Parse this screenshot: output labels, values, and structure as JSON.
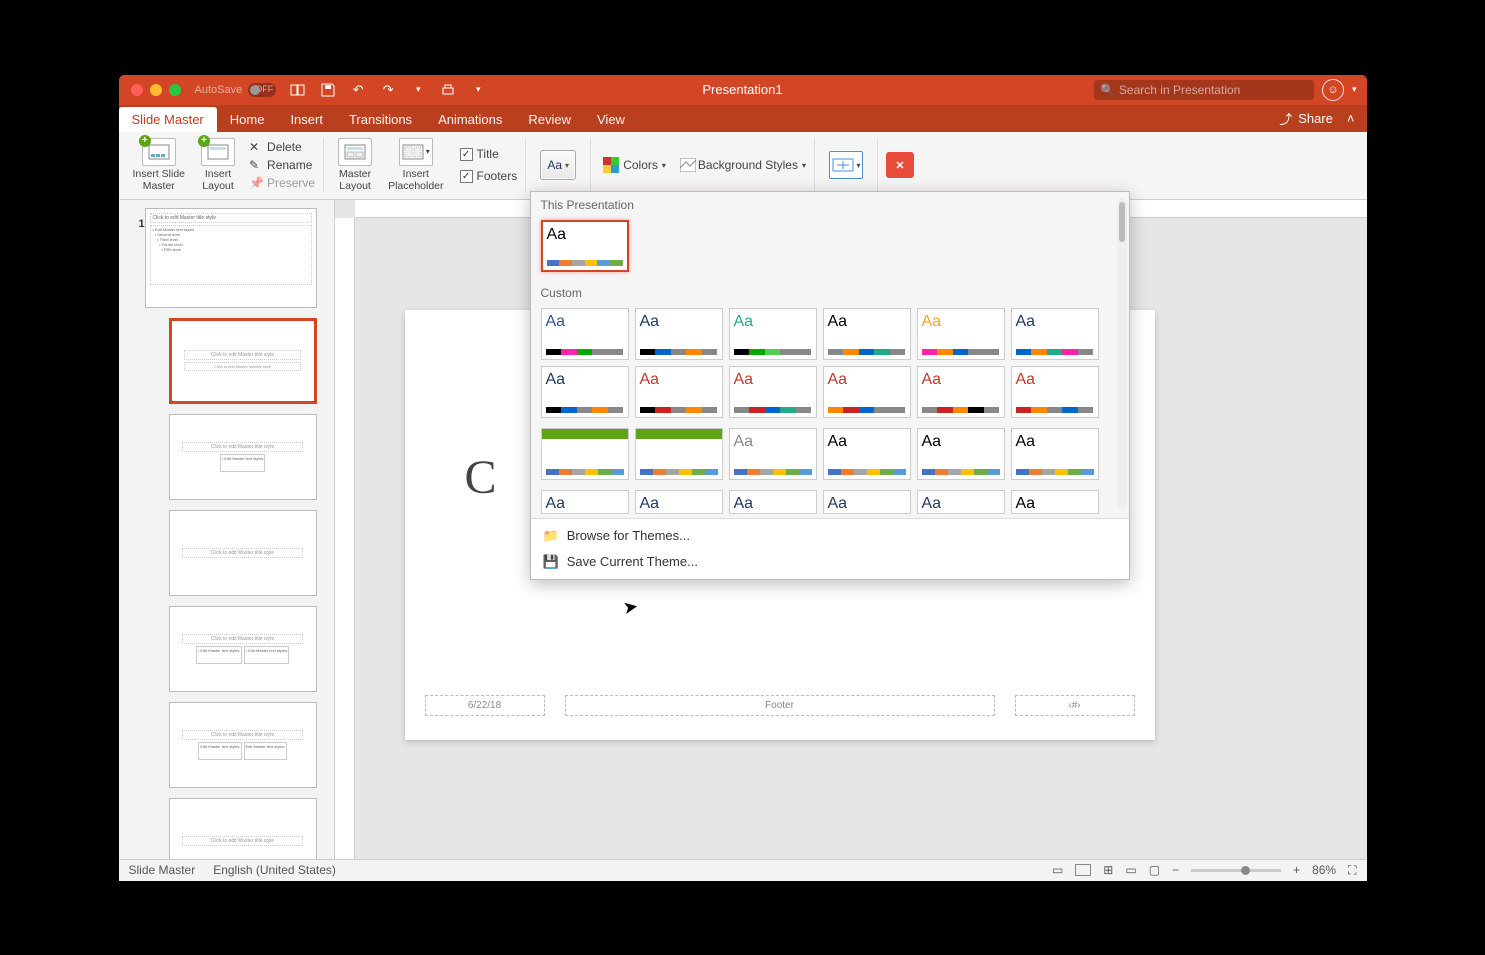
{
  "titlebar": {
    "autosave_label": "AutoSave",
    "autosave_state": "OFF",
    "doc_title": "Presentation1",
    "search_placeholder": "Search in Presentation"
  },
  "tabs": {
    "items": [
      "Slide Master",
      "Home",
      "Insert",
      "Transitions",
      "Animations",
      "Review",
      "View"
    ],
    "active": "Slide Master",
    "share": "Share"
  },
  "ribbon": {
    "insert_slide_master": "Insert Slide\nMaster",
    "insert_layout": "Insert\nLayout",
    "delete": "Delete",
    "rename": "Rename",
    "preserve": "Preserve",
    "master_layout": "Master\nLayout",
    "insert_placeholder": "Insert\nPlaceholder",
    "title_chk": "Title",
    "footers_chk": "Footers",
    "colors": "Colors",
    "background_styles": "Background Styles"
  },
  "themes_popup": {
    "section1": "This Presentation",
    "section2": "Custom",
    "browse": "Browse for Themes...",
    "save": "Save Current Theme...",
    "aa": "Aa",
    "custom_colors": [
      [
        "#2F5496",
        "#000",
        "#f2a",
        "#0a0",
        "#888"
      ],
      [
        "#1F3864",
        "#000",
        "#06c",
        "#888",
        "#f80"
      ],
      [
        "#2a8",
        "#000",
        "#0a0",
        "#5c5",
        "#888"
      ],
      [
        "#000",
        "#888",
        "#f80",
        "#06c",
        "#2a8"
      ],
      [
        "#f5a623",
        "#f2a",
        "#f80",
        "#06c",
        "#888"
      ],
      [
        "#1F3864",
        "#06c",
        "#f80",
        "#2a8",
        "#f2a"
      ],
      [
        "#1F3864",
        "#000",
        "#06c",
        "#888",
        "#f80"
      ],
      [
        "#c0392b",
        "#000",
        "#c22",
        "#888",
        "#f80"
      ],
      [
        "#c0392b",
        "#888",
        "#c22",
        "#06c",
        "#2a8"
      ],
      [
        "#c0392b",
        "#f80",
        "#c22",
        "#06c",
        "#888"
      ],
      [
        "#c0392b",
        "#888",
        "#c22",
        "#f80",
        "#000"
      ],
      [
        "#c0392b",
        "#c22",
        "#f80",
        "#888",
        "#06c"
      ]
    ],
    "row3": [
      {
        "bg": "#5BA517",
        "aa": "#fff"
      },
      {
        "bg": "#5BA517",
        "aa": "#fff"
      },
      {
        "aa": "#888"
      },
      {
        "aa": "#000"
      },
      {
        "aa": "#000"
      },
      {
        "aa": "#000"
      }
    ],
    "row4_aa_colors": [
      "#1F3864",
      "#1F3864",
      "#1F3864",
      "#1F3864",
      "#1F3864",
      "#000"
    ]
  },
  "thumbs": {
    "index": "1",
    "master_title": "Click to edit Master title style",
    "layout_title": "Click to edit Master title style"
  },
  "slide": {
    "title_initial": "C",
    "date": "6/22/18",
    "footer": "Footer",
    "num_ph": "‹#›"
  },
  "statusbar": {
    "view": "Slide Master",
    "lang": "English (United States)",
    "zoom": "86%"
  }
}
